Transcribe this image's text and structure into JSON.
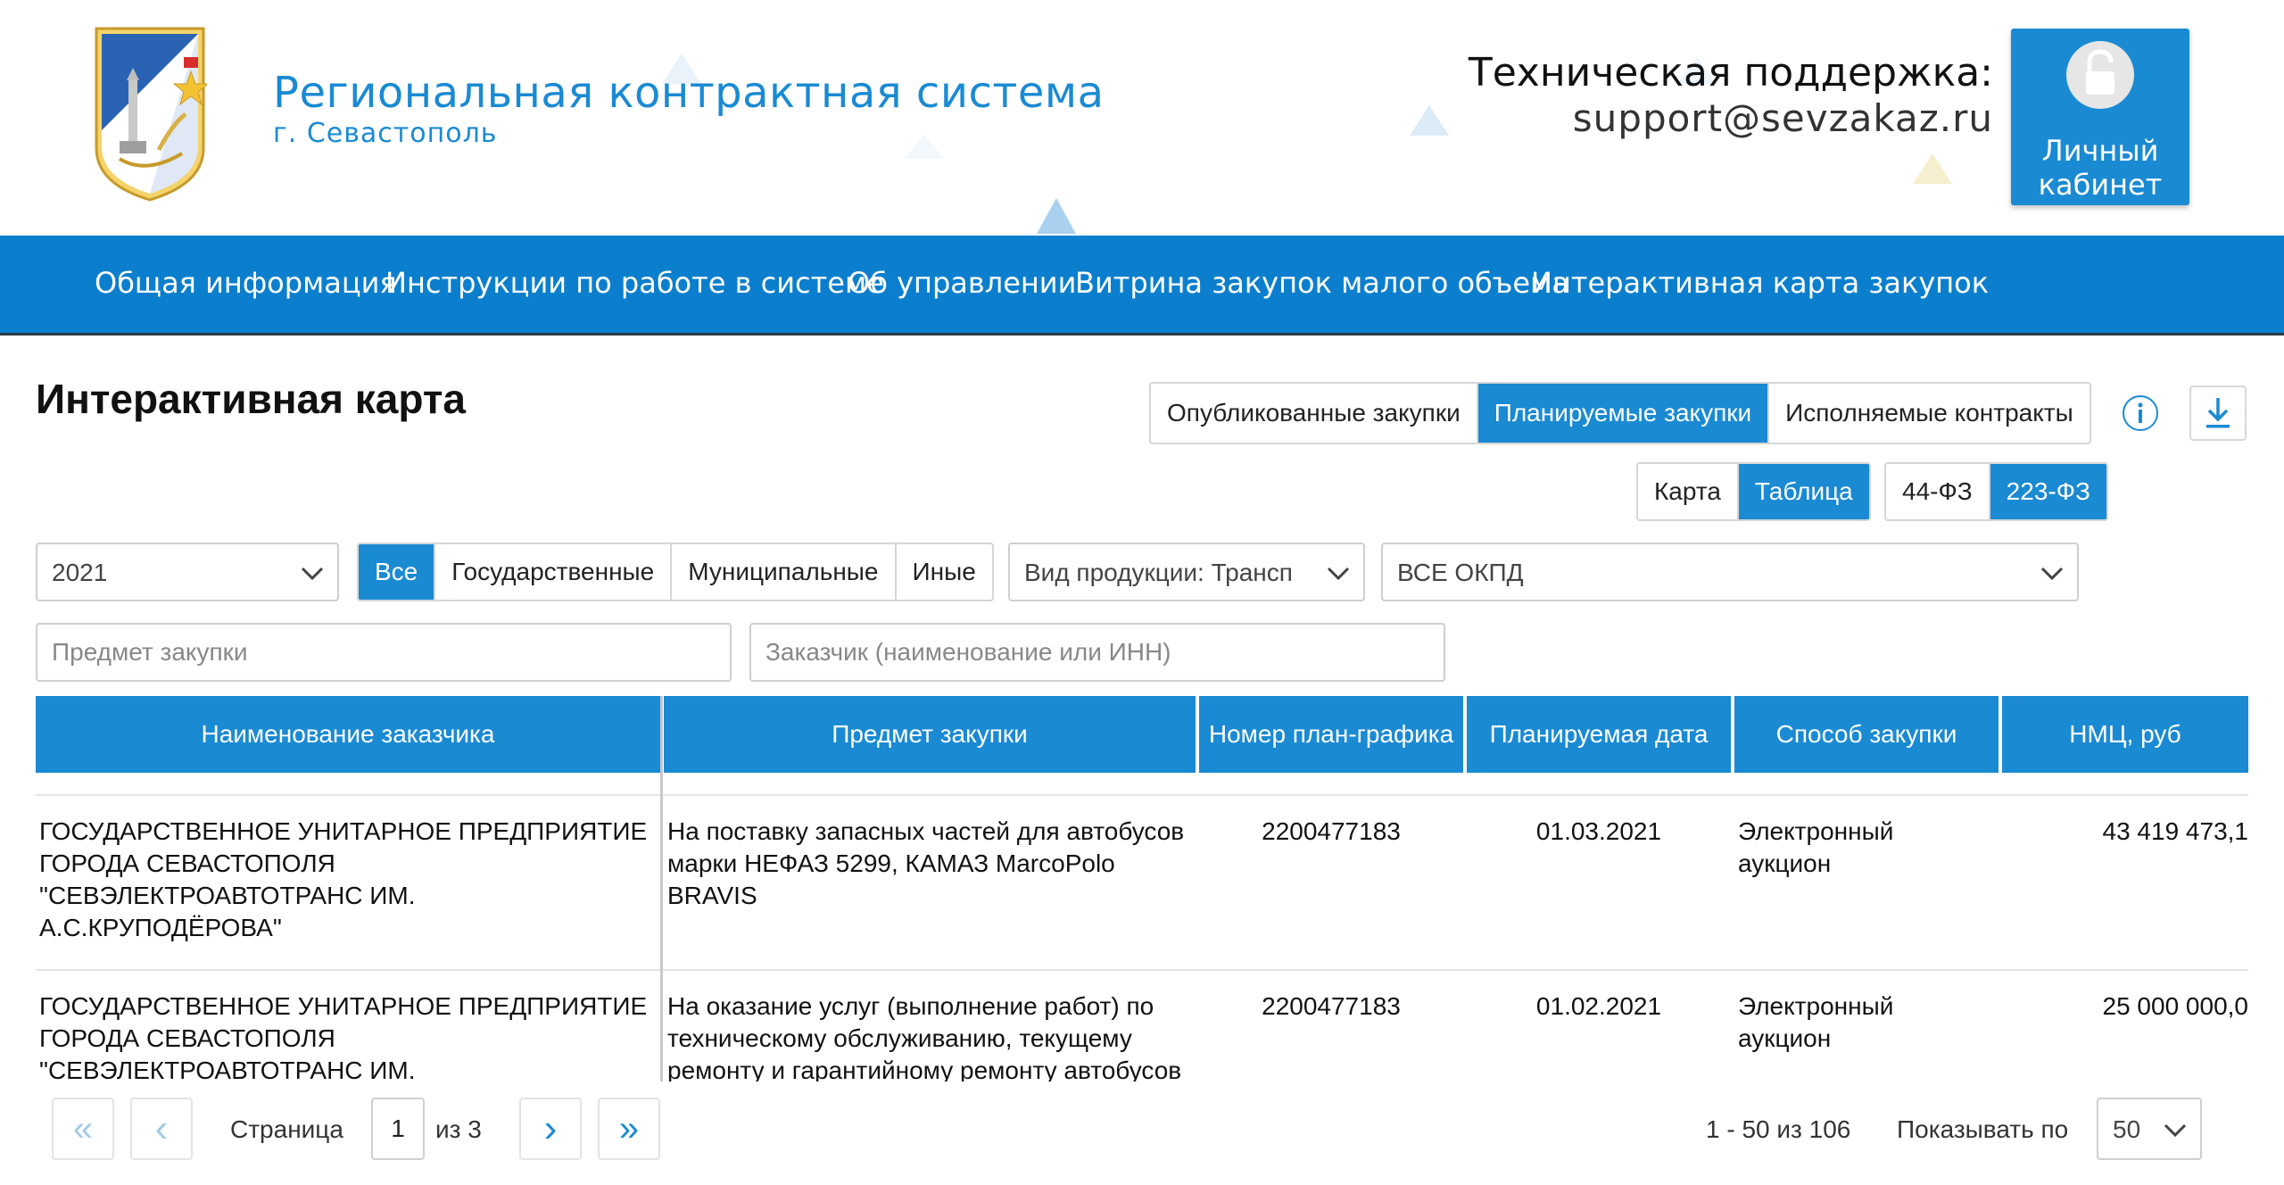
{
  "header": {
    "site_title": "Региональная контрактная система",
    "site_subtitle": "г. Севастополь",
    "support_title": "Техническая поддержка:",
    "support_email": "support@sevzakaz.ru",
    "cabinet_line1": "Личный",
    "cabinet_line2": "кабинет",
    "cabinet_icon": "lock-icon"
  },
  "nav": {
    "items": [
      "Общая информация",
      "Инструкции по работе в системе",
      "Об управлении",
      "Витрина закупок малого объема",
      "Интерактивная карта закупок"
    ]
  },
  "page": {
    "title": "Интерактивная карта"
  },
  "procurement_tabs": {
    "items": [
      "Опубликованные закупки",
      "Планируемые закупки",
      "Исполняемые контракты"
    ],
    "active": "Планируемые закупки"
  },
  "view_toggle": {
    "items": [
      "Карта",
      "Таблица"
    ],
    "active": "Таблица"
  },
  "law_toggle": {
    "items": [
      "44-ФЗ",
      "223-ФЗ"
    ],
    "active": "223-ФЗ"
  },
  "filters": {
    "year": "2021",
    "owner_types": [
      "Все",
      "Государственные",
      "Муниципальные",
      "Иные"
    ],
    "owner_active": "Все",
    "product_type": "Вид продукции: Трансп",
    "okpd": "ВСЕ ОКПД",
    "subject_placeholder": "Предмет закупки",
    "customer_placeholder": "Заказчик (наименование или ИНН)"
  },
  "table": {
    "headers": [
      "Наименование заказчика",
      "Предмет закупки",
      "Номер план-графика",
      "Планируемая дата",
      "Способ закупки",
      "НМЦ, руб"
    ],
    "rows": [
      {
        "customer": "ГОСУДАРСТВЕННОЕ УНИТАРНОЕ ПРЕДПРИЯТИЕ ГОРОДА СЕВАСТОПОЛЯ \"СЕВЭЛЕКТРОАВТОТРАНС ИМ. А.С.КРУПОДЁРОВА\"",
        "subject": "На поставку запасных частей для автобусов марки НЕФАЗ 5299, КАМАЗ MarcoPolo BRAVIS",
        "plan_number": "2200477183",
        "date": "01.03.2021",
        "method": "Электронный аукцион",
        "price": "43 419 473,1"
      },
      {
        "customer": "ГОСУДАРСТВЕННОЕ УНИТАРНОЕ ПРЕДПРИЯТИЕ ГОРОДА СЕВАСТОПОЛЯ \"СЕВЭЛЕКТРОАВТОТРАНС ИМ. А.С.КРУПОДЁРОВА\"",
        "subject": "На оказание услуг (выполнение работ) по техническому обслуживанию, текущему ремонту и гарантийному ремонту автобусов марки КАВЗ",
        "plan_number": "2200477183",
        "date": "01.02.2021",
        "method": "Электронный аукцион",
        "price": "25 000 000,0"
      }
    ]
  },
  "pager": {
    "first": "«",
    "prev": "‹",
    "next": "›",
    "last": "»",
    "page_label": "Страница",
    "current_page": "1",
    "of_label": "из 3",
    "range": "1 - 50 из 106",
    "per_page_label": "Показывать по",
    "per_page": "50"
  },
  "colors": {
    "accent": "#1a8ad3",
    "nav": "#0b7fcd"
  }
}
